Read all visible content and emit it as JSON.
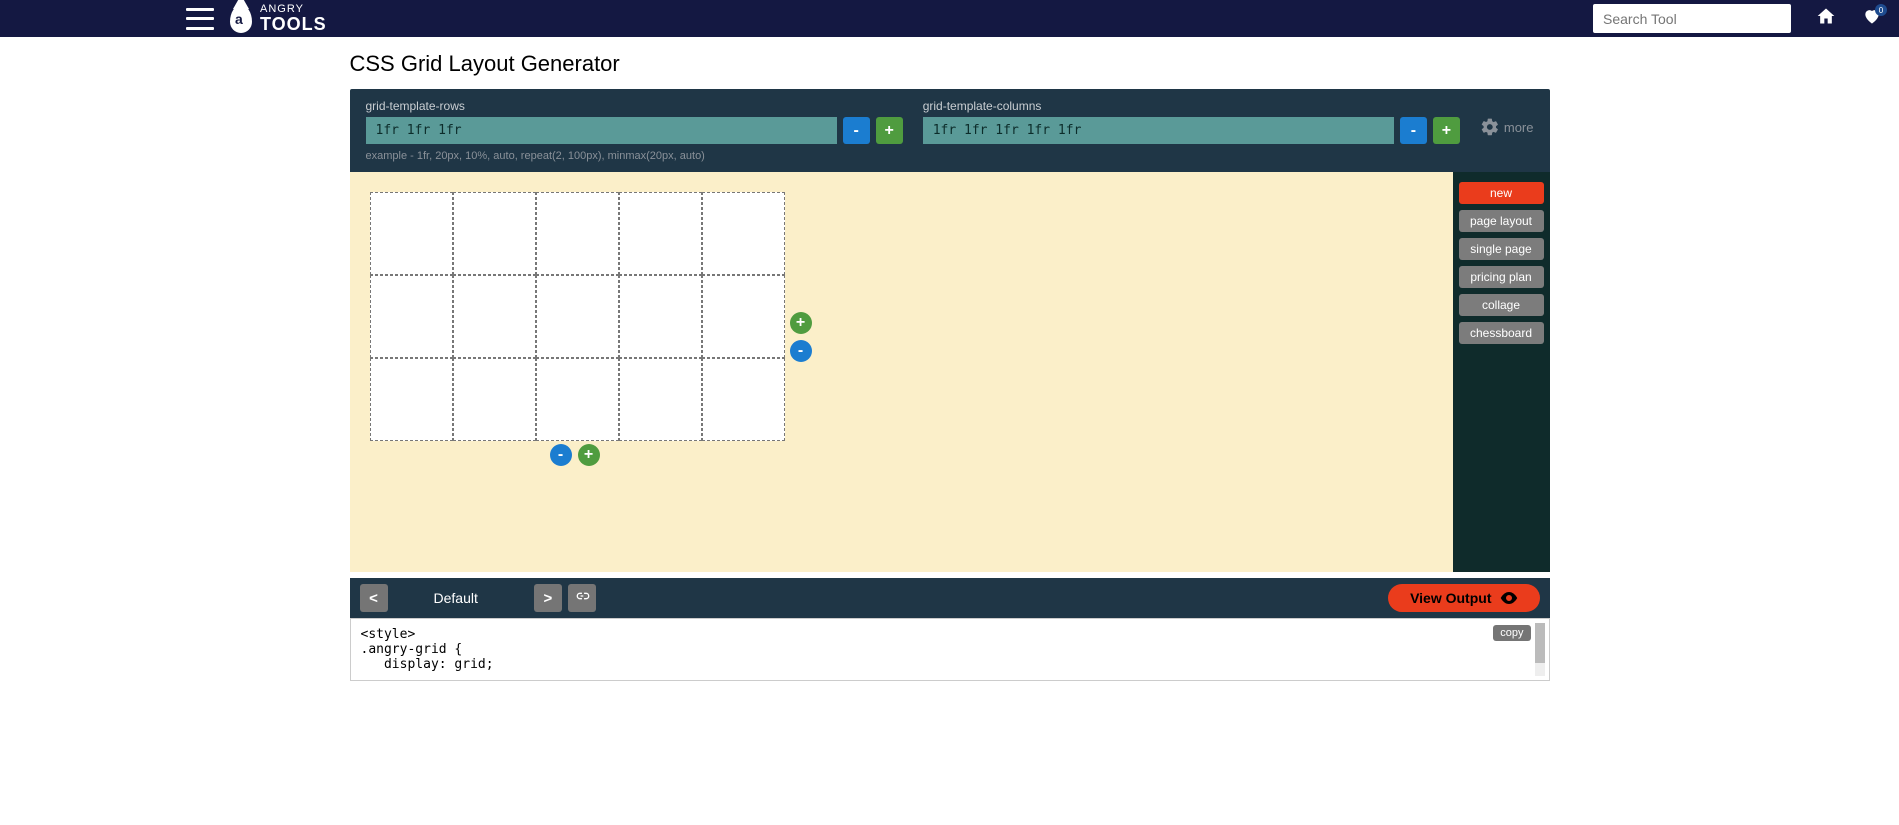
{
  "header": {
    "logo_small": "ANGRY",
    "logo_big": "TOOLS",
    "logo_letter": "a",
    "search_placeholder": "Search Tool",
    "fav_count": "0"
  },
  "page": {
    "title": "CSS Grid Layout Generator"
  },
  "controls": {
    "rows_label": "grid-template-rows",
    "rows_value": "1fr 1fr 1fr",
    "cols_label": "grid-template-columns",
    "cols_value": "1fr 1fr 1fr 1fr 1fr",
    "minus": "-",
    "plus": "+",
    "example": "example - 1fr, 20px, 10%, auto, repeat(2, 100px), minmax(20px, auto)",
    "more": "more"
  },
  "grid": {
    "rows": 3,
    "cols": 5
  },
  "presets": {
    "items": [
      {
        "label": "new",
        "kind": "red"
      },
      {
        "label": "page layout",
        "kind": "gray"
      },
      {
        "label": "single page",
        "kind": "gray"
      },
      {
        "label": "pricing plan",
        "kind": "gray"
      },
      {
        "label": "collage",
        "kind": "gray"
      },
      {
        "label": "chessboard",
        "kind": "gray"
      }
    ]
  },
  "bottom": {
    "prev": "<",
    "next": ">",
    "label": "Default",
    "view_output": "View Output",
    "copy": "copy"
  },
  "code": "<style>\n.angry-grid {\n   display: grid;"
}
